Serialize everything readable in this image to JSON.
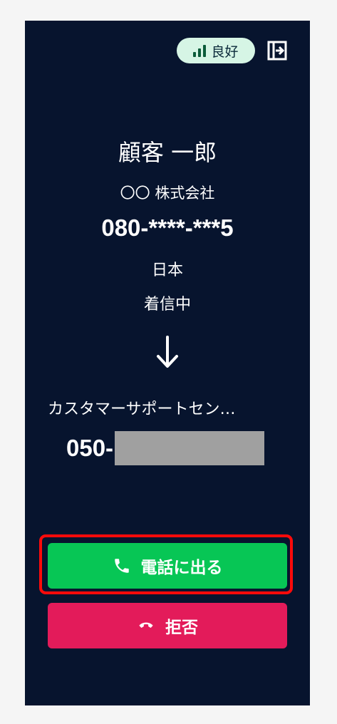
{
  "status": {
    "icon": "signal-bars-icon",
    "label": "良好",
    "color": "#d6f5e5"
  },
  "header": {
    "exit_icon": "exit-panel-icon"
  },
  "caller": {
    "name": "顧客 一郎",
    "company": "〇〇 株式会社",
    "number": "080-****-***5",
    "country": "日本"
  },
  "call": {
    "status": "着信中",
    "direction_icon": "arrow-down-icon"
  },
  "destination": {
    "name": "カスタマーサポートセン…",
    "number_prefix": "050-"
  },
  "actions": {
    "answer_label": "電話に出る",
    "answer_icon": "phone-icon",
    "answer_color": "#07c655",
    "reject_label": "拒否",
    "reject_icon": "hang-up-icon",
    "reject_color": "#e31b5a",
    "highlight_color": "#ff0a0a"
  },
  "theme": {
    "panel_background": "#07142e"
  }
}
